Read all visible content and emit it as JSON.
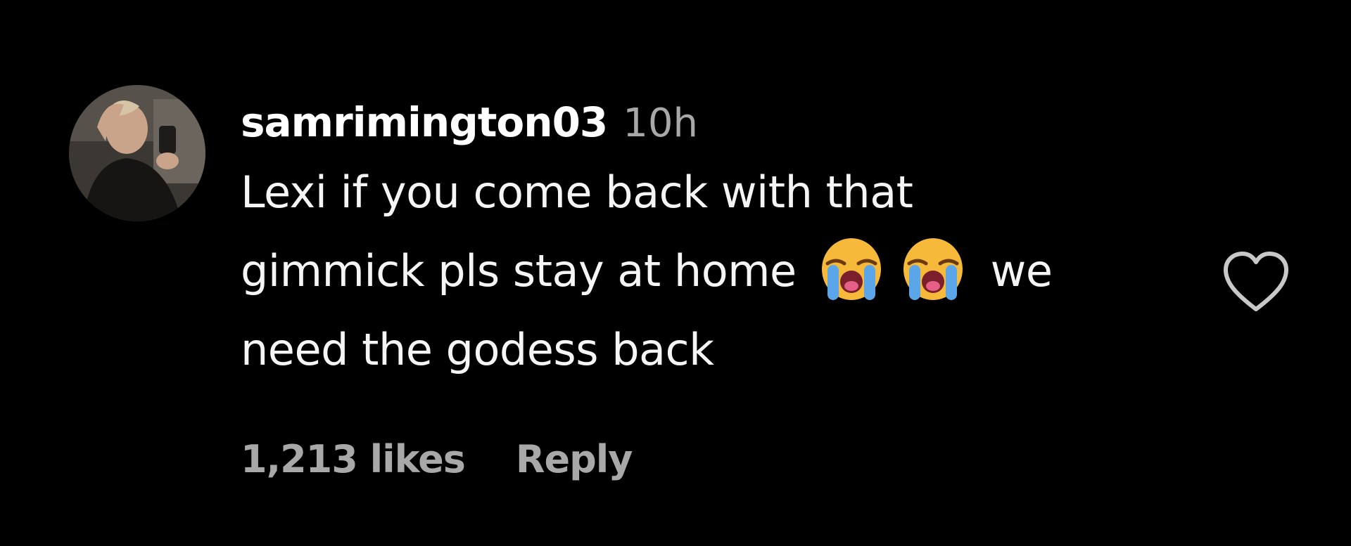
{
  "comment": {
    "username": "samrimington03",
    "timestamp": "10h",
    "text_line1": "Lexi if you come back with that",
    "text_line2_before": "gimmick pls stay at home",
    "text_line2_after": "we",
    "text_line3": "need the godess back",
    "emojis": [
      "loudly-crying-face-icon",
      "loudly-crying-face-icon"
    ],
    "likes": "1,213 likes",
    "reply_label": "Reply"
  },
  "colors": {
    "background": "#000000",
    "primary_text": "#ffffff",
    "secondary_text": "#a8a8a8"
  },
  "icons": {
    "like": "heart-outline-icon",
    "avatar": "user-avatar-photo"
  }
}
